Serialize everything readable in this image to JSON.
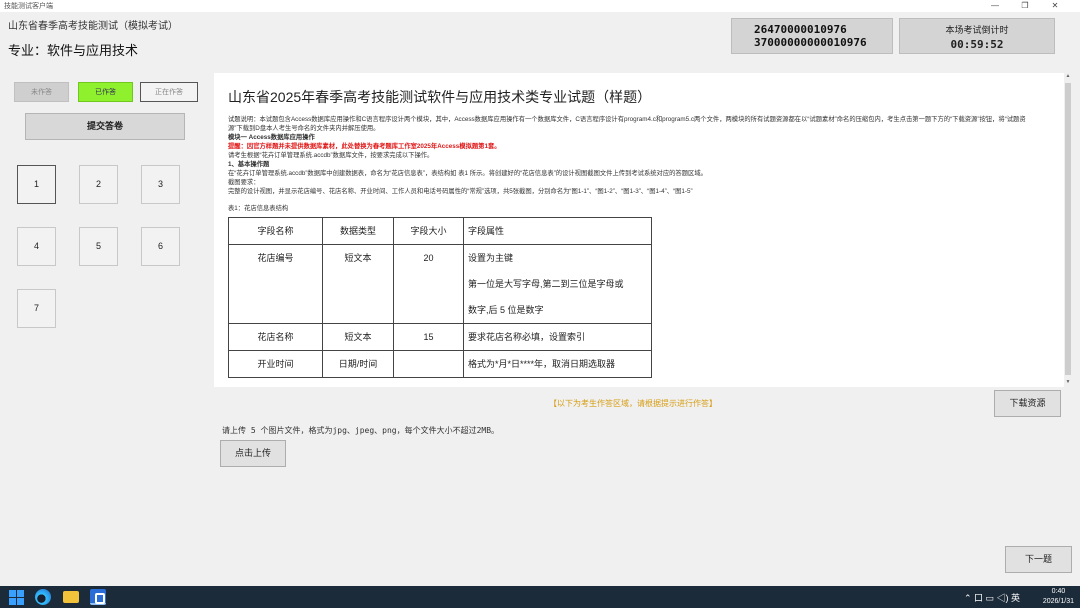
{
  "window": {
    "title": "技能测试客户端",
    "controls": [
      "—",
      "❐",
      "✕"
    ]
  },
  "header": {
    "exam_title": "山东省春季高考技能测试（模拟考试）",
    "major": "专业：软件与应用技术",
    "id_line1": "26470000010976",
    "id_line2": "37000000000010976",
    "timer_label": "本场考试倒计时",
    "timer_value": "00:59:52"
  },
  "legend": {
    "unanswered": "未作答",
    "answered": "已作答",
    "current": "正在作答"
  },
  "submit_label": "提交答卷",
  "questions": [
    "1",
    "2",
    "3",
    "4",
    "5",
    "6",
    "7"
  ],
  "content": {
    "title": "山东省2025年春季高考技能测试软件与应用技术类专业试题（样题）",
    "intro": "试题说明：本试题包含Access数据库应用操作和C语言程序设计两个模块，其中，Access数据库应用操作有一个数据库文件，C语言程序设计有program4.c和program5.c两个文件，两模块的所有试题资源都在以“试题素材”命名的压缩包内，考生点击第一题下方的“下载资源”按钮，将“试题资源”下载到D盘本人考生号命名的文件夹内并解压使用。",
    "module1": "模块一 Access数据库应用操作",
    "warning": "提醒：因官方样题并未提供数据库素材，此处替换为春考题库工作室2025年Access模拟题第1套。",
    "instruction": "请考生根据“花卉订单管理系统.accdb”数据库文件，按要求完成以下操作。",
    "section1": "1、基本操作题",
    "task": "在“花卉订单管理系统.accdb”数据库中创建数据表，命名为“花店信息表”，表结构如 表1 所示。将创建好的“花店信息表”的设计视图截图文件上传到考试系统对应的答题区域。",
    "screenshot_req": "截图要求：",
    "screenshot_desc": "完整的设计视图，并显示花店编号、花店名称、开业时间、工作人员和电话号码属性的“常规”选项，共5张截图，分别命名为“图1-1”、“图1-2”、“图1-3”、“图1-4”、“图1-5”",
    "table_caption": "表1：花店信息表结构",
    "table_headers": [
      "字段名称",
      "数据类型",
      "字段大小",
      "字段属性"
    ],
    "rows": [
      {
        "name": "花店编号",
        "type": "短文本",
        "size": "20",
        "props": [
          "设置为主键",
          "第一位是大写字母,第二到三位是字母或",
          "数字,后 5 位是数字"
        ]
      },
      {
        "name": "花店名称",
        "type": "短文本",
        "size": "15",
        "props": [
          "要求花店名称必填，设置索引"
        ]
      },
      {
        "name": "开业时间",
        "type": "日期/时间",
        "size": "",
        "props": [
          "格式为*月*日****年，取消日期选取器"
        ]
      }
    ]
  },
  "answer": {
    "hint": "【以下为考生作答区域，请根据提示进行作答】",
    "download_label": "下载资源",
    "upload_tip": "请上传 5 个图片文件，格式为jpg、jpeg、png，每个文件大小不超过2MB。",
    "upload_label": "点击上传",
    "next_label": "下一题"
  },
  "taskbar": {
    "tray": "⌃ 口 ▭ ◁) 英",
    "time": "0:40",
    "date": "2026/1/31"
  }
}
